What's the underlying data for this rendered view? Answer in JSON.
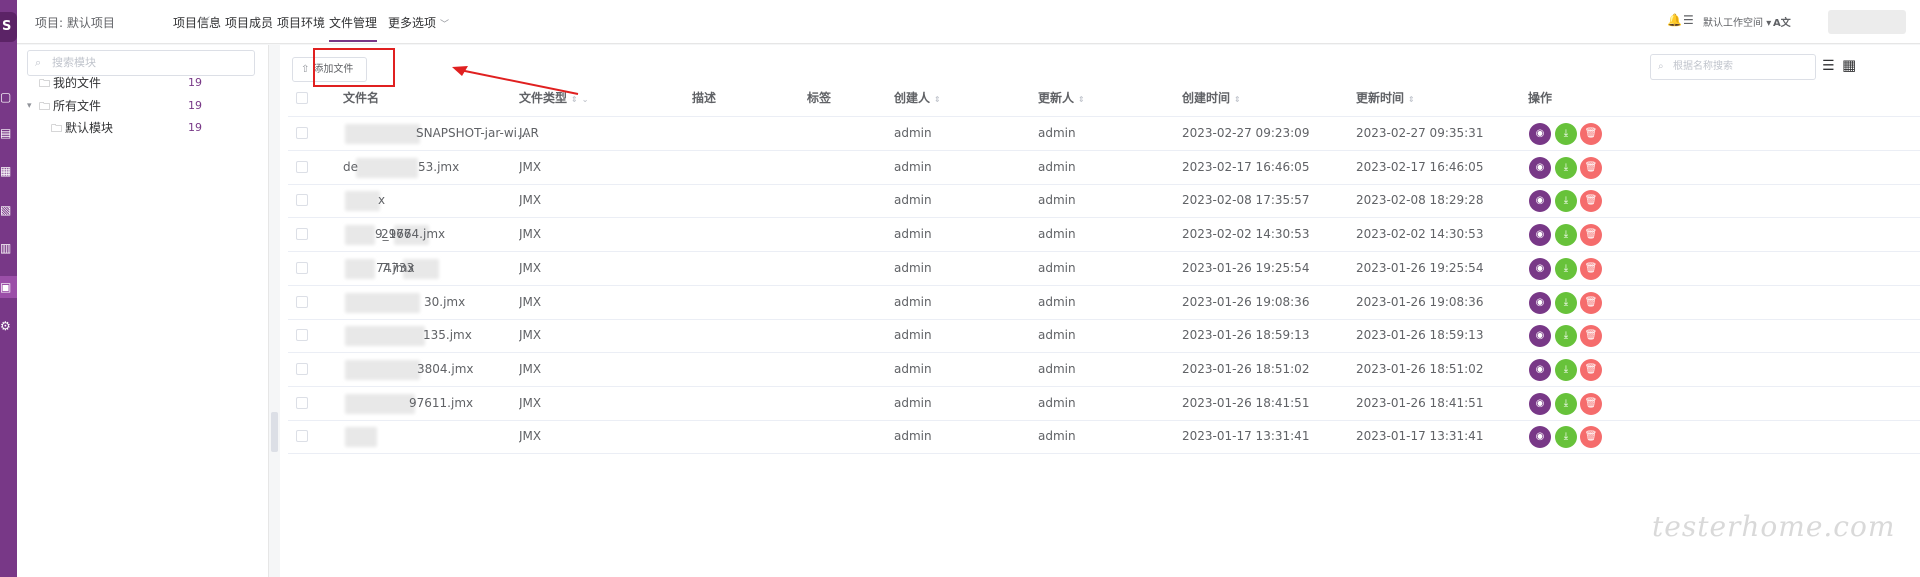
{
  "topbar": {
    "project_label": "项目: 默认项目",
    "nav": [
      "项目信息",
      "项目成员",
      "项目环境",
      "文件管理",
      "更多选项"
    ],
    "active_nav_index": 3,
    "workspace_label": "默认工作空间"
  },
  "tree": {
    "search_placeholder": "搜索模块",
    "nodes": [
      {
        "label": "我的文件",
        "count": "19"
      },
      {
        "label": "所有文件",
        "count": "19"
      },
      {
        "label": "默认模块",
        "count": "19"
      }
    ]
  },
  "main": {
    "add_button_label": "添加文件",
    "search_placeholder": "根据名称搜索",
    "columns": [
      "文件名",
      "文件类型",
      "描述",
      "标签",
      "创建人",
      "更新人",
      "创建时间",
      "更新时间",
      "操作"
    ],
    "rows": [
      {
        "name": "SNAPSHOT-jar-wi...",
        "type": "JAR",
        "creator": "admin",
        "updater": "admin",
        "created": "2023-02-27 09:23:09",
        "updated": "2023-02-27 09:35:31"
      },
      {
        "name": "53.jmx",
        "name_prefix": "de",
        "type": "JMX",
        "creator": "admin",
        "updater": "admin",
        "created": "2023-02-17 16:46:05",
        "updated": "2023-02-17 16:46:05"
      },
      {
        "name": "x",
        "type": "JMX",
        "creator": "admin",
        "updater": "admin",
        "created": "2023-02-08 17:35:57",
        "updated": "2023-02-08 18:29:28"
      },
      {
        "name": "29764.jmx",
        "name_prefix": "9_167",
        "type": "JMX",
        "creator": "admin",
        "updater": "admin",
        "created": "2023-02-02 14:30:53",
        "updated": "2023-02-02 14:30:53"
      },
      {
        "name": "7.jmx",
        "name_prefix": "74733",
        "type": "JMX",
        "creator": "admin",
        "updater": "admin",
        "created": "2023-01-26 19:25:54",
        "updated": "2023-01-26 19:25:54"
      },
      {
        "name": "30.jmx",
        "type": "JMX",
        "creator": "admin",
        "updater": "admin",
        "created": "2023-01-26 19:08:36",
        "updated": "2023-01-26 19:08:36"
      },
      {
        "name": "135.jmx",
        "type": "JMX",
        "creator": "admin",
        "updater": "admin",
        "created": "2023-01-26 18:59:13",
        "updated": "2023-01-26 18:59:13"
      },
      {
        "name": "3804.jmx",
        "type": "JMX",
        "creator": "admin",
        "updater": "admin",
        "created": "2023-01-26 18:51:02",
        "updated": "2023-01-26 18:51:02"
      },
      {
        "name": "97611.jmx",
        "type": "JMX",
        "creator": "admin",
        "updater": "admin",
        "created": "2023-01-26 18:41:51",
        "updated": "2023-01-26 18:41:51"
      },
      {
        "name": "",
        "type": "JMX",
        "creator": "admin",
        "updater": "admin",
        "created": "2023-01-17 13:31:41",
        "updated": "2023-01-17 13:31:41"
      }
    ]
  },
  "watermark": "testerhome.com",
  "colors": {
    "accent": "#783887",
    "view": "#783887",
    "download": "#67c23a",
    "delete": "#f56c6c",
    "annotation": "#e02020"
  }
}
